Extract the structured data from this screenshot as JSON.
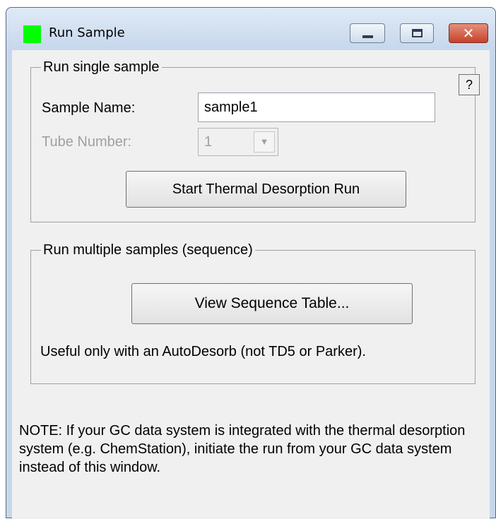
{
  "window": {
    "title": "Run Sample",
    "close_glyph": "✕"
  },
  "single": {
    "legend": "Run single sample",
    "help_label": "?",
    "sample_name_label": "Sample Name:",
    "sample_name_value": "sample1",
    "tube_number_label": "Tube Number:",
    "tube_number_value": "1",
    "combo_arrow": "▼",
    "start_button": "Start Thermal Desorption Run"
  },
  "multiple": {
    "legend": "Run multiple samples (sequence)",
    "view_button": "View Sequence Table...",
    "useful_note": "Useful only with an AutoDesorb (not TD5 or Parker)."
  },
  "note": "NOTE: If your GC data system is integrated with the thermal desorption system (e.g. ChemStation), initiate the run from your GC data system instead of this window.",
  "colors": {
    "app_icon": "#00ff00",
    "close_button": "#c6412a",
    "dialog_face": "#f0f0f0"
  }
}
